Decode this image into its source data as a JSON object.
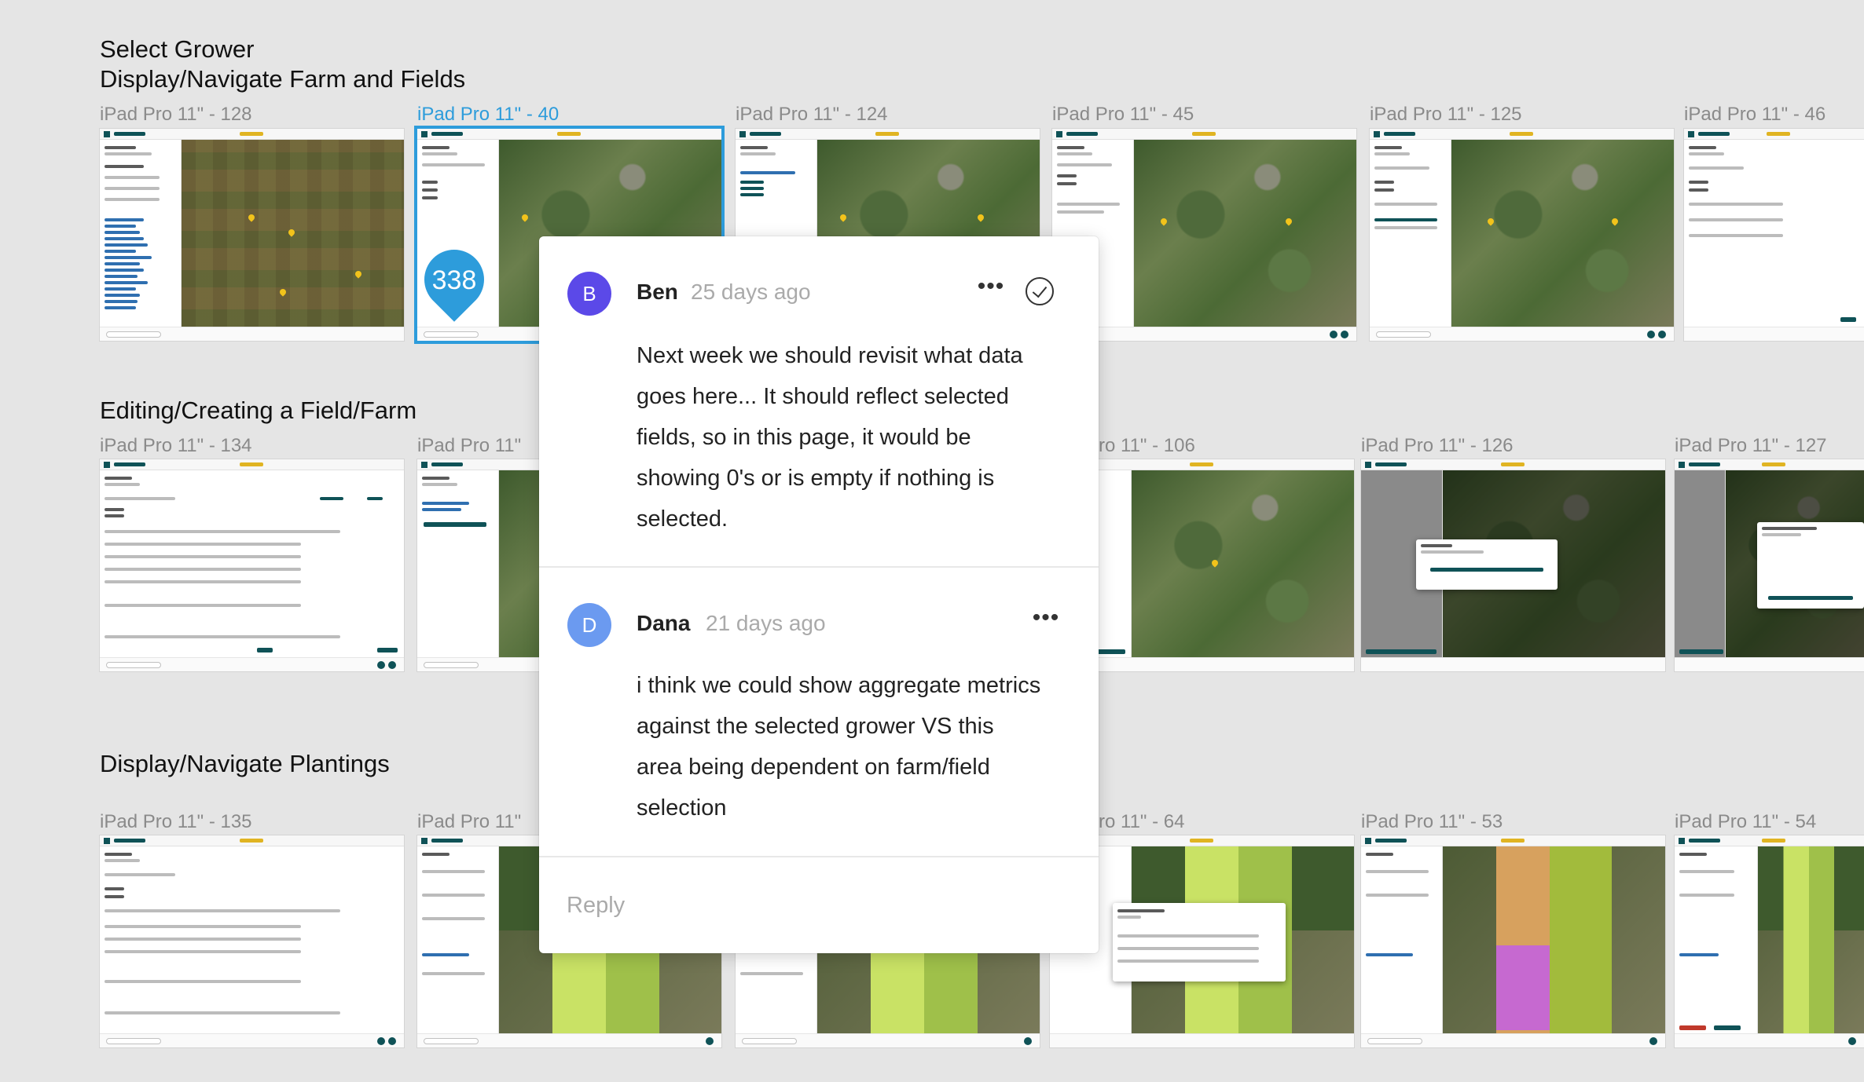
{
  "sections": {
    "s1_line1": "Select Grower",
    "s1_line2": "Display/Navigate Farm and Fields",
    "s2": "Editing/Creating a Field/Farm",
    "s3": "Display/Navigate Plantings"
  },
  "frames": {
    "r1": [
      "iPad Pro 11\" - 128",
      "iPad Pro 11\" - 40",
      "iPad Pro 11\" - 124",
      "iPad Pro 11\" - 45",
      "iPad Pro 11\" - 125",
      "iPad Pro 11\" - 46"
    ],
    "r2": [
      "iPad Pro 11\" - 134",
      "iPad Pro 11\"",
      "ro 11\" - 106",
      "iPad Pro 11\" - 126",
      "iPad Pro 11\" - 127"
    ],
    "r3": [
      "iPad Pro 11\" - 135",
      "iPad Pro 11\"",
      "ro 11\" - 64",
      "iPad Pro 11\" - 53",
      "iPad Pro 11\" - 54"
    ]
  },
  "comment_badge": {
    "count": "338"
  },
  "comments": [
    {
      "avatar_letter": "B",
      "author": "Ben",
      "age": "25 days ago",
      "more_icon": "more-horizontal-icon",
      "resolve_icon": "check-circle-icon",
      "text": "Next week we should revisit what data goes here...   It should reflect selected fields, so in this page, it would be showing 0's or is empty if nothing is selected."
    },
    {
      "avatar_letter": "D",
      "author": "Dana",
      "age": "21 days ago",
      "more_icon": "more-horizontal-icon",
      "text": "i think we could show aggregate metrics against the selected grower VS this area being dependent on farm/field selection"
    }
  ],
  "reply_placeholder": "Reply",
  "colors": {
    "canvas": "#e5e5e5",
    "selection": "#2d9cdb",
    "avatar_b": "#5b49e8",
    "avatar_d": "#6b9af0",
    "app_primary": "#0f5257",
    "brand_accent": "#e0b422"
  }
}
